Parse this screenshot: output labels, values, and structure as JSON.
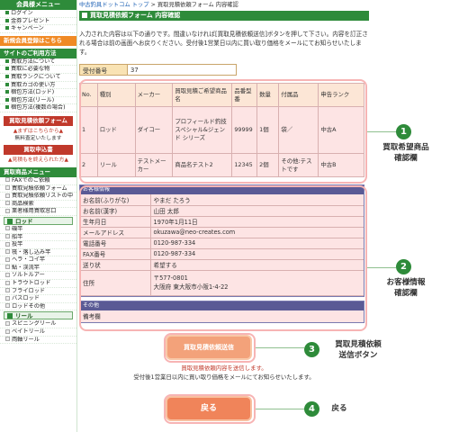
{
  "sidebar": {
    "member_menu": "会員様メニュー",
    "member_items": [
      "ログイン",
      "金券プレゼント",
      "キャンペーン"
    ],
    "new_member": "新規会員登録はこちら",
    "site_usage": "サイトのご利用方法",
    "usage_items": [
      "買取方法について",
      "買取に必要な物",
      "買取ランクについて",
      "買取カゴの使い方",
      "梱包方法(ロッド)",
      "梱包方法(リール)",
      "梱包方法(複数の場合)"
    ],
    "estimate_banner": "買取見積依頼フォーム",
    "estimate_note": "▲まずはこちらから▲",
    "estimate_note2": "無料査定いたします",
    "apply_banner": "買取申込書",
    "apply_note": "▲見積もを終えられた方▲",
    "product_menu": "買取商品メニュー",
    "product_items": [
      "FAXでのご依頼",
      "買取見積依頼フォーム",
      "買取見積依頼リストの中",
      "商品検索",
      "業者様用買取窓口"
    ],
    "rod_category": "ロッド",
    "rod_items": [
      "磯竿",
      "船竿",
      "投竿",
      "筏・落し込み竿",
      "ヘラ・コイ竿",
      "鮎・渓流竿",
      "ソルトルアー",
      "トラウトロッド",
      "フライロッド",
      "バスロッド",
      "ロッドその他"
    ],
    "reel_category": "リール",
    "reel_items": [
      "スピニングリール",
      "ベイトリール",
      "両軸リール"
    ]
  },
  "breadcrumb": {
    "home": "中古釣具ドットコム トップ",
    "sep": " > ",
    "current": "買取見積依頼フォーム 内容確認"
  },
  "title": "買取見積依頼フォーム 内容確認",
  "intro": "入力された内容は以下の通りです。間違いなければ[買取見積依頼送信]ボタンを押して下さい。内容を訂正される場合は前の画面へお戻りください。受付後1営業日以内に買い取り価格をメールにてお知らせいたします。",
  "reception": {
    "label": "受付番号",
    "value": "37"
  },
  "items_table": {
    "headers": [
      "No.",
      "種別",
      "メーカー",
      "買取見積ご希望商品名",
      "品番型番",
      "数量",
      "付属品",
      "申告ランク"
    ],
    "rows": [
      [
        "1",
        "ロッド",
        "ダイコー",
        "プロフィールド釣技スペシャル&ジェンド シリーズ",
        "99999",
        "1個",
        "袋／",
        "中古A"
      ],
      [
        "2",
        "リール",
        "テストメーカー",
        "商品名テスト2",
        "12345",
        "2個",
        "その他:テストです",
        "中古B"
      ]
    ]
  },
  "customer": {
    "section_title": "お客様情報",
    "rows": [
      {
        "label": "お名前(ふりがな)",
        "value": "やまだ たろう"
      },
      {
        "label": "お名前(漢字)",
        "value": "山田 太郎"
      },
      {
        "label": "生年月日",
        "value": "1970年1月11日"
      },
      {
        "label": "メールアドレス",
        "value": "okuzawa@neo-creates.com"
      },
      {
        "label": "電話番号",
        "value": "0120-987-334"
      },
      {
        "label": "FAX番号",
        "value": "0120-987-334"
      },
      {
        "label": "送り状",
        "value": "希望する"
      }
    ],
    "address_label": "住所",
    "address_lines": [
      "〒577-0801",
      "大阪府 東大阪市小阪1-4-22"
    ]
  },
  "other": {
    "section_title": "その他",
    "label": "備考欄",
    "value": ""
  },
  "send_button": "買取見積依頼送信",
  "send_note_red": "買取見積依頼内容を送信します。",
  "send_note": "受付後1営業日以内に買い取り価格をメールにてお知らせいたします。",
  "back_button": "戻る",
  "annotations": [
    {
      "num": "1",
      "text": "買取希望商品\n確認欄"
    },
    {
      "num": "2",
      "text": "お客様情報\n確認欄"
    },
    {
      "num": "3",
      "text": "買取見積依頼\n送信ボタン"
    },
    {
      "num": "4",
      "text": "戻る"
    }
  ],
  "colors": {
    "green": "#2e8b3a",
    "orange": "#f08a24",
    "pink_bg": "#fde4e4",
    "button": "#f3a27a",
    "navy": "#5a5a95"
  }
}
